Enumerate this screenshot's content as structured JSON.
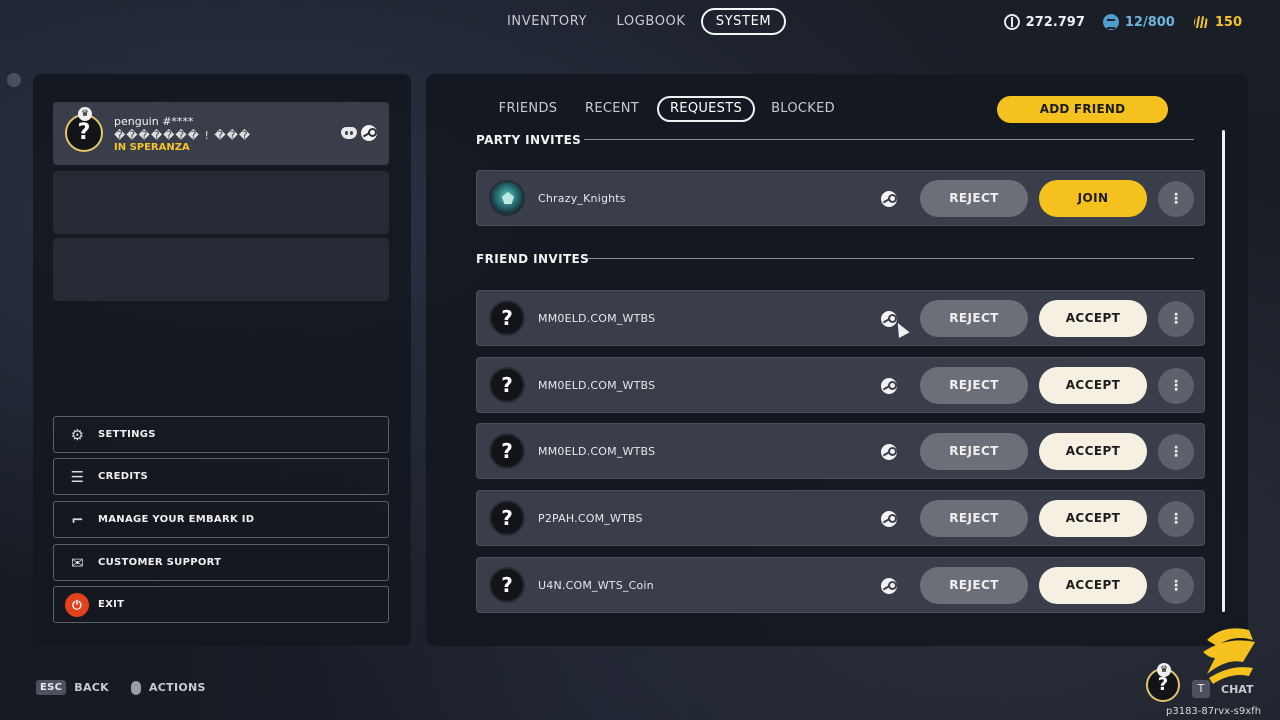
{
  "nav": {
    "tabs": [
      {
        "label": "INVENTORY"
      },
      {
        "label": "LOGBOOK"
      },
      {
        "label": "SYSTEM"
      }
    ],
    "currencies": [
      {
        "icon": "coin-icon",
        "value": "272.797"
      },
      {
        "icon": "ticket-icon",
        "value": "12/800"
      },
      {
        "icon": "credits-icon",
        "value": "150"
      }
    ]
  },
  "profile": {
    "name": "penguin #****",
    "subtitle": "������� ! ���",
    "status": "IN SPERANZA",
    "avatar_glyph": "?"
  },
  "menu": [
    {
      "label": "SETTINGS",
      "icon": "gear-icon"
    },
    {
      "label": "CREDITS",
      "icon": "list-icon"
    },
    {
      "label": "MANAGE YOUR EMBARK ID",
      "icon": "boot-icon"
    },
    {
      "label": "CUSTOMER SUPPORT",
      "icon": "chat-bubbles-icon"
    },
    {
      "label": "EXIT",
      "icon": "power-icon"
    }
  ],
  "subtabs": [
    {
      "label": "FRIENDS"
    },
    {
      "label": "RECENT"
    },
    {
      "label": "REQUESTS"
    },
    {
      "label": "BLOCKED"
    }
  ],
  "add_friend_label": "ADD FRIEND",
  "sections": {
    "party_title": "PARTY INVITES",
    "friend_title": "FRIEND INVITES"
  },
  "party_invites": [
    {
      "name": "Chrazy_Knights",
      "reject": "REJECT",
      "join": "JOIN"
    }
  ],
  "friend_invites": [
    {
      "name": "MM0ELD.COM_WTBS",
      "reject": "REJECT",
      "accept": "ACCEPT"
    },
    {
      "name": "MM0ELD.COM_WTBS",
      "reject": "REJECT",
      "accept": "ACCEPT"
    },
    {
      "name": "MM0ELD.COM_WTBS",
      "reject": "REJECT",
      "accept": "ACCEPT"
    },
    {
      "name": "P2PAH.COM_WTBS",
      "reject": "REJECT",
      "accept": "ACCEPT"
    },
    {
      "name": "U4N.COM_WTS_Coin",
      "reject": "REJECT",
      "accept": "ACCEPT"
    }
  ],
  "row_more_glyph": "⋮",
  "footer": {
    "esc_key": "ESC",
    "back_label": "BACK",
    "actions_label": "ACTIONS",
    "chat_key": "T",
    "chat_label": "CHAT",
    "version": "p3183-87rvx-s9xfh"
  },
  "colors": {
    "accent_yellow": "#f4c11f",
    "accept_bg": "#f6f0e3",
    "reject_bg": "#6c6f78",
    "exit_red": "#e2421e"
  }
}
